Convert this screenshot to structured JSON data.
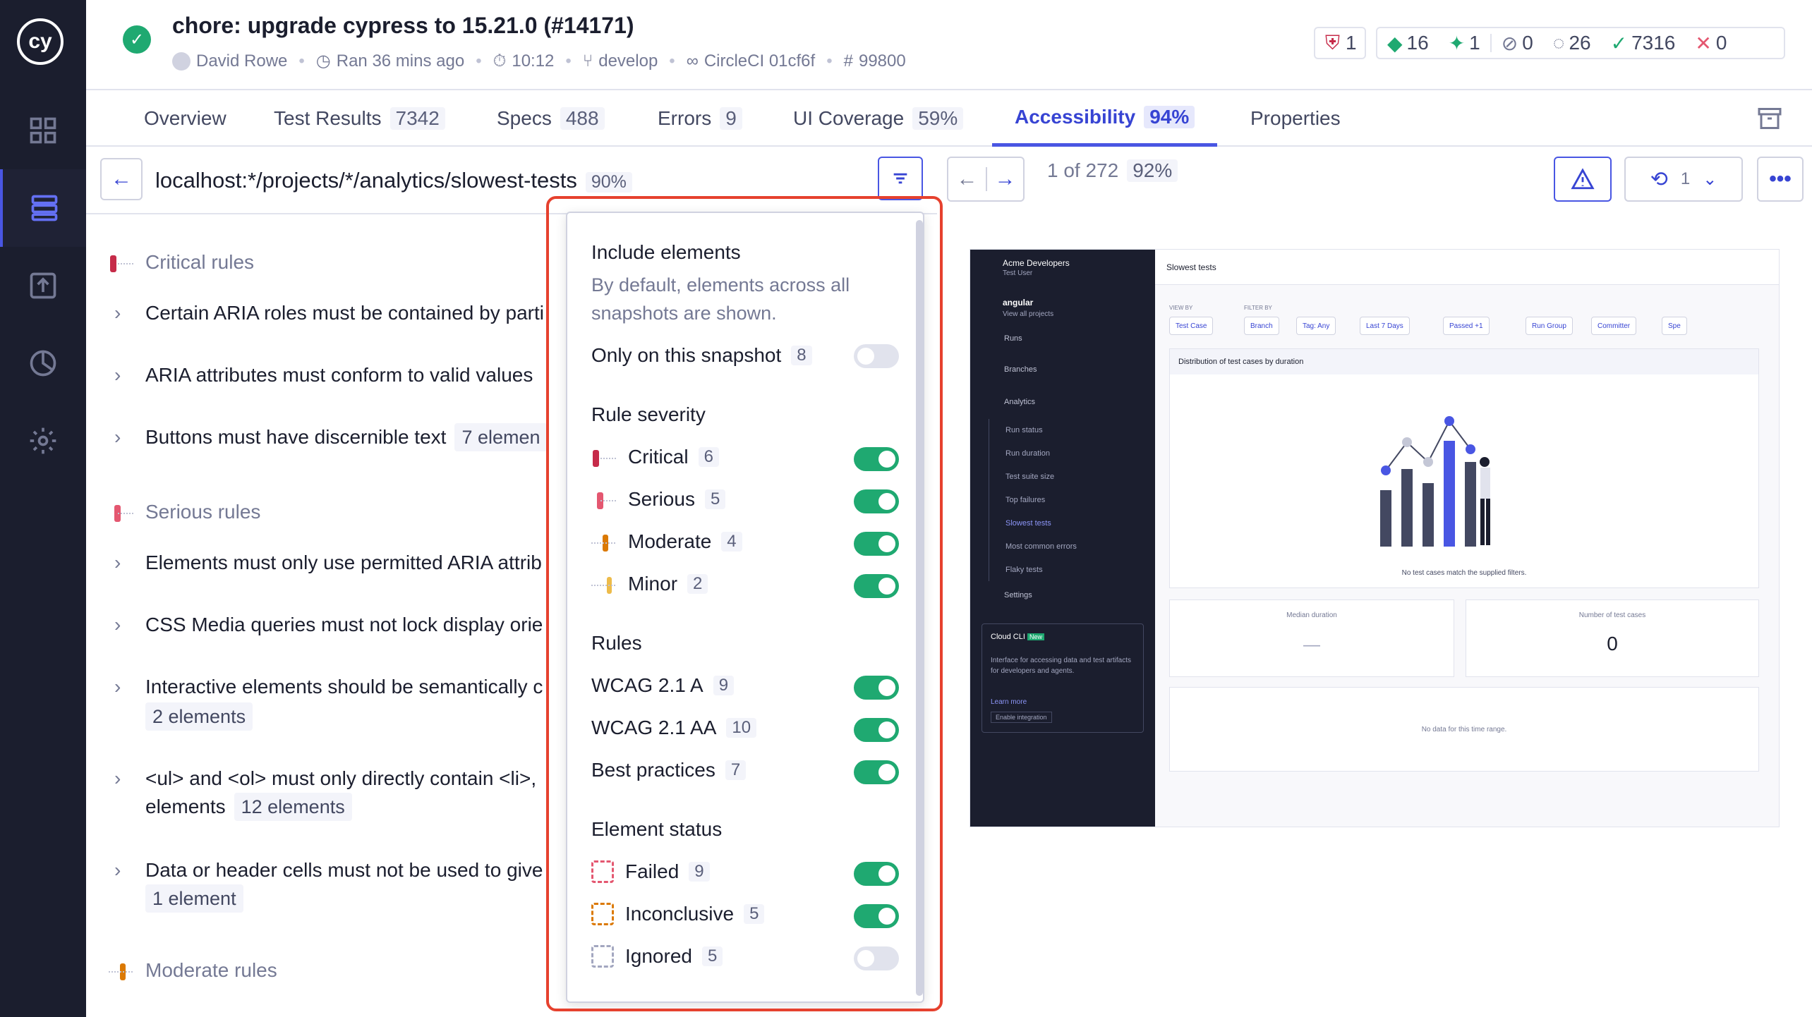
{
  "header": {
    "title": "chore: upgrade cypress to 15.21.0 (#14171)",
    "author": "David Rowe",
    "ran": "Ran 36 mins ago",
    "duration": "10:12",
    "branch": "develop",
    "ci": "CircleCI 01cf6f",
    "run_number": "99800",
    "flaky_count": "1",
    "stats": {
      "changed": "16",
      "added": "1",
      "skipped": "0",
      "pending": "26",
      "passed": "7316",
      "failed": "0"
    }
  },
  "tabs": [
    {
      "label": "Overview",
      "count": ""
    },
    {
      "label": "Test Results",
      "count": "7342"
    },
    {
      "label": "Specs",
      "count": "488"
    },
    {
      "label": "Errors",
      "count": "9"
    },
    {
      "label": "UI Coverage",
      "count": "59%"
    },
    {
      "label": "Accessibility",
      "count": "94%"
    },
    {
      "label": "Properties",
      "count": ""
    }
  ],
  "url_bar": {
    "url": "localhost:*/projects/*/analytics/slowest-tests",
    "score": "90%"
  },
  "pager": {
    "position": "1 of 272",
    "score": "92%",
    "view_count": "1"
  },
  "rules_panel": {
    "critical_title": "Critical rules",
    "serious_title": "Serious rules",
    "moderate_title": "Moderate rules",
    "rules": [
      {
        "text": "Certain ARIA roles must be contained by parti",
        "badge": ""
      },
      {
        "text": "ARIA attributes must conform to valid values",
        "badge": ""
      },
      {
        "text": "Buttons must have discernible text",
        "badge": "7 elemen"
      },
      {
        "text": "Elements must only use permitted ARIA attrib",
        "badge": ""
      },
      {
        "text": "CSS Media queries must not lock display orie",
        "badge": ""
      },
      {
        "text": "Interactive elements should be semantically c",
        "badge": "2 elements"
      },
      {
        "text": "<ul> and <ol> must only directly contain <li>,",
        "line2": "elements",
        "badge": "12 elements"
      },
      {
        "text": "Data or header cells must not be used to give",
        "badge": "1 element"
      }
    ]
  },
  "filter_popover": {
    "include_title": "Include elements",
    "include_desc": "By default, elements across all snapshots are shown.",
    "only_snapshot": {
      "label": "Only on this snapshot",
      "count": "8",
      "on": false
    },
    "severity_title": "Rule severity",
    "severity": [
      {
        "label": "Critical",
        "count": "6",
        "on": true,
        "color": "#c62b49"
      },
      {
        "label": "Serious",
        "count": "5",
        "on": true,
        "color": "#e45770"
      },
      {
        "label": "Moderate",
        "count": "4",
        "on": true,
        "color": "#db7903"
      },
      {
        "label": "Minor",
        "count": "2",
        "on": true,
        "color": "#edbb4a"
      }
    ],
    "rules_title": "Rules",
    "rules": [
      {
        "label": "WCAG 2.1 A",
        "count": "9",
        "on": true
      },
      {
        "label": "WCAG 2.1 AA",
        "count": "10",
        "on": true
      },
      {
        "label": "Best practices",
        "count": "7",
        "on": true
      }
    ],
    "status_title": "Element status",
    "status": [
      {
        "label": "Failed",
        "count": "9",
        "on": true
      },
      {
        "label": "Inconclusive",
        "count": "5",
        "on": true
      },
      {
        "label": "Ignored",
        "count": "5",
        "on": false
      }
    ]
  },
  "snapshot": {
    "org": "Acme Developers",
    "user": "Test User",
    "project": "angular",
    "view_all": "View all projects",
    "nav": [
      "Runs",
      "Branches",
      "Analytics"
    ],
    "analytics_sub": [
      "Run status",
      "Run duration",
      "Test suite size",
      "Top failures",
      "Slowest tests",
      "Most common errors",
      "Flaky tests"
    ],
    "settings": "Settings",
    "cloud_title": "Cloud CLI",
    "cloud_new": "New",
    "cloud_desc": "Interface for accessing data and test artifacts for developers and agents.",
    "learn_more": "Learn more",
    "enable": "Enable integration",
    "page_title": "Slowest tests",
    "view_by": "VIEW BY",
    "filter_by": "FILTER BY",
    "filters": [
      "Test Case",
      "Branch",
      "Tag: Any",
      "Last 7 Days",
      "Passed +1",
      "Run Group",
      "Committer",
      "Spe"
    ],
    "chart_title": "Distribution of test cases by duration",
    "no_match": "No test cases match the supplied filters.",
    "median_label": "Median duration",
    "median_value": "—",
    "count_label": "Number of test cases",
    "count_value": "0",
    "no_data": "No data for this time range."
  }
}
